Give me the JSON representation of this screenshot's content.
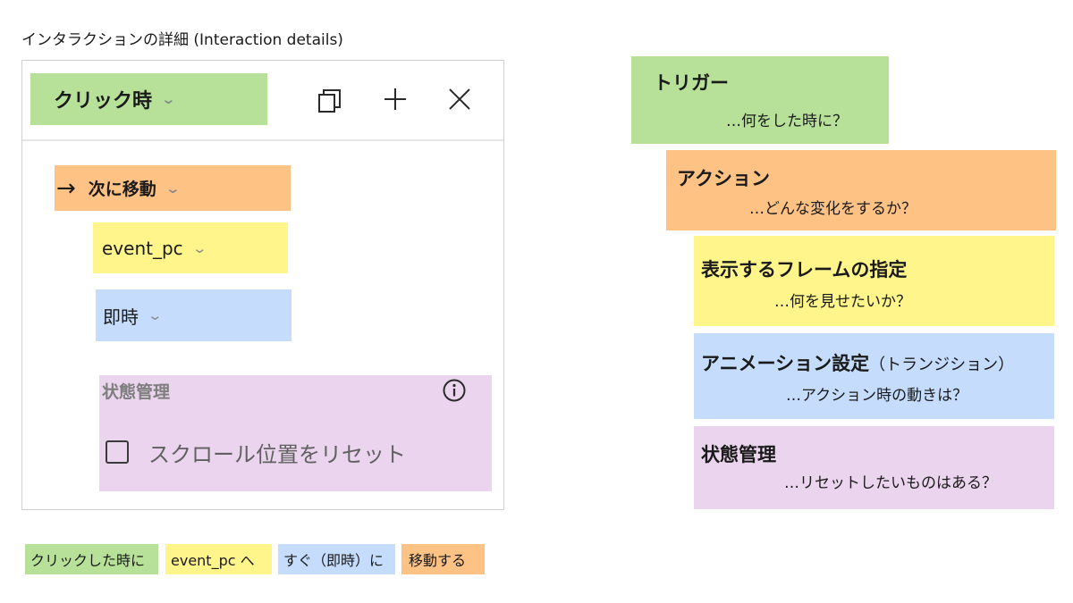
{
  "caption": "インタラクションの詳細 (Interaction details)",
  "panel": {
    "trigger_label": "クリック時",
    "action_label": "次に移動",
    "frame_label": "event_pc",
    "timing_label": "即時",
    "state_label": "状態管理",
    "reset_scroll_label": "スクロール位置をリセット",
    "reset_scroll_checked": false
  },
  "sentence": [
    "クリックした時に",
    "event_pc へ",
    "すぐ（即時）に",
    "移動する"
  ],
  "legend": {
    "trigger": {
      "title": "トリガー",
      "question": "…何をした時に？"
    },
    "action": {
      "title": "アクション",
      "question": "…どんな変化をするか？"
    },
    "frame": {
      "title": "表示するフレームの指定",
      "question": "…何を見せたいか？"
    },
    "animation": {
      "title": "アニメーション設定",
      "title_paren": "（トランジション）",
      "question": "…アクション時の動きは？"
    },
    "state": {
      "title": "状態管理",
      "question": "…リセットしたいものはある？"
    }
  },
  "colors": {
    "trigger": "#b7e199",
    "action": "#ffc285",
    "frame": "#fff58a",
    "animation": "#c5dcfd",
    "state": "#ebd4ee"
  },
  "icons": [
    "copy-icon",
    "add-icon",
    "close-icon",
    "arrow-right-icon",
    "chevron-down-icon",
    "info-icon",
    "checkbox-icon"
  ]
}
